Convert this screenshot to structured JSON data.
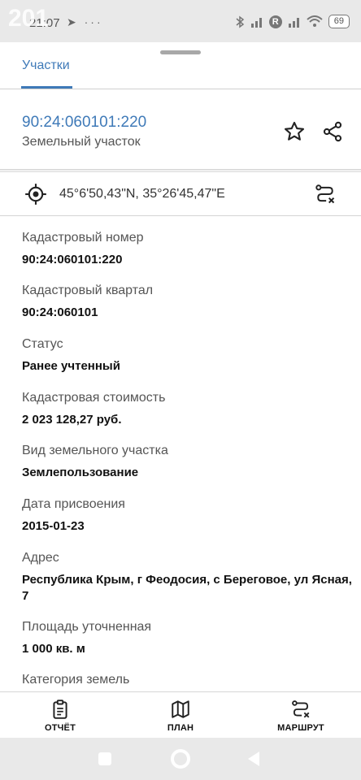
{
  "status_bar": {
    "time": "21:07",
    "overlay_number": "201",
    "left_icons": "➤ ···",
    "battery": "69"
  },
  "tab": {
    "label": "Участки"
  },
  "parcel": {
    "number": "90:24:060101:220",
    "type": "Земельный участок"
  },
  "coordinates": "45°6'50,43\"N, 35°26'45,47\"E",
  "fields": [
    {
      "label": "Кадастровый номер",
      "value": "90:24:060101:220"
    },
    {
      "label": "Кадастровый квартал",
      "value": "90:24:060101"
    },
    {
      "label": "Статус",
      "value": "Ранее учтенный"
    },
    {
      "label": "Кадастровая стоимость",
      "value": "2 023 128,27 руб."
    },
    {
      "label": "Вид земельного участка",
      "value": "Землепользование"
    },
    {
      "label": "Дата присвоения",
      "value": "2015-01-23"
    },
    {
      "label": "Адрес",
      "value": "Республика Крым, г Феодосия, с Береговое, ул Ясная, 7"
    },
    {
      "label": "Площадь уточненная",
      "value": "1 000 кв. м"
    },
    {
      "label": "Категория земель",
      "value": ""
    }
  ],
  "bottom_nav": {
    "report": "ОТЧЁТ",
    "plan": "ПЛАН",
    "route": "МАРШРУТ"
  },
  "colors": {
    "accent": "#3f7ab8",
    "status_bar_bg": "#e9e9e9"
  },
  "icons": [
    "telegram-icon",
    "bluetooth-icon",
    "signal-icon",
    "wifi-icon",
    "battery-icon",
    "star-icon",
    "share-icon",
    "locate-icon",
    "route-icon",
    "report-icon",
    "map-icon"
  ]
}
